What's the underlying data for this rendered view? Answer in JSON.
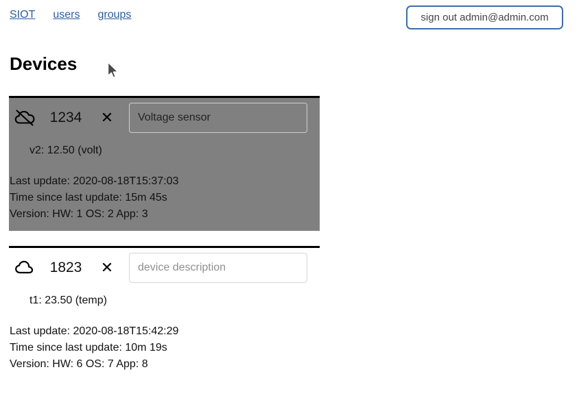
{
  "nav": {
    "links": [
      {
        "label": "SIOT",
        "name": "nav-link-siot"
      },
      {
        "label": "users",
        "name": "nav-link-users"
      },
      {
        "label": "groups",
        "name": "nav-link-groups"
      }
    ],
    "signout_label": "sign out admin@admin.com"
  },
  "page": {
    "title": "Devices"
  },
  "colors": {
    "link": "#2a5d9f",
    "button_border": "#3a6ea5",
    "selected_card_bg": "#808080",
    "card_top_border": "#000000"
  },
  "devices": [
    {
      "name": "device-card-1234",
      "selected": true,
      "connection_icon": "cloud-off-icon",
      "id": "1234",
      "delete_label": "✕",
      "description_value": "Voltage sensor",
      "description_placeholder": "device description",
      "points": [
        "v2: 12.50 (volt)"
      ],
      "meta": [
        "Last update: 2020-08-18T15:37:03",
        "Time since last update: 15m 45s",
        "Version: HW: 1 OS: 2 App: 3"
      ]
    },
    {
      "name": "device-card-1823",
      "selected": false,
      "connection_icon": "cloud-icon",
      "id": "1823",
      "delete_label": "✕",
      "description_value": "",
      "description_placeholder": "device description",
      "points": [
        "t1: 23.50 (temp)"
      ],
      "meta": [
        "Last update: 2020-08-18T15:42:29",
        "Time since last update: 10m 19s",
        "Version: HW: 6 OS: 7 App: 8"
      ]
    }
  ]
}
